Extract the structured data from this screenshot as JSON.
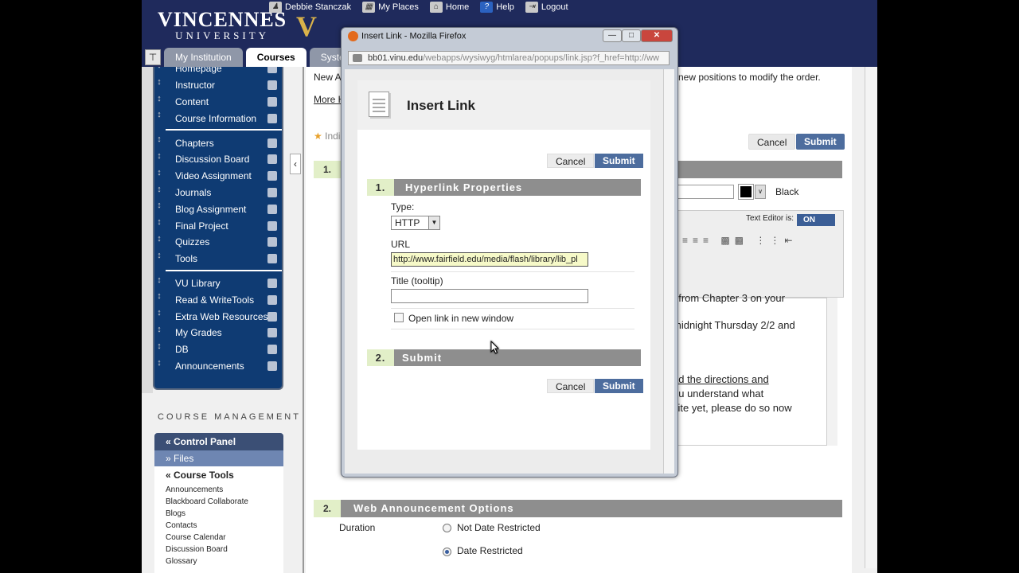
{
  "header": {
    "logo_main": "VINCENNES",
    "logo_sub": "UNIVERSITY",
    "user": "Debbie Stanczak",
    "links": [
      "My Places",
      "Home",
      "Help",
      "Logout"
    ]
  },
  "tabs": [
    "My Institution",
    "Courses",
    "Syste"
  ],
  "left_nav": {
    "group1": [
      "Homepage",
      "Instructor",
      "Content",
      "Course Information"
    ],
    "group2": [
      "Chapters",
      "Discussion Board",
      "Video Assignment",
      "Journals",
      "Blog Assignment",
      "Final Project",
      "Quizzes",
      "Tools"
    ],
    "group3": [
      "VU Library",
      "Read & WriteTools",
      "Extra Web Resources",
      "My Grades",
      "DB",
      "Announcements"
    ]
  },
  "course_management": {
    "title": "COURSE MANAGEMENT",
    "control_panel": "Control Panel",
    "files": "Files",
    "course_tools": "Course Tools",
    "tools": [
      "Announcements",
      "Blackboard Collaborate",
      "Blogs",
      "Contacts",
      "Course Calendar",
      "Discussion Board",
      "Glossary"
    ]
  },
  "main": {
    "intro": "New A",
    "intro_right": "new positions to modify the order.",
    "more_help": "More H",
    "indicates": "Indi",
    "cancel": "Cancel",
    "submit": "Submit",
    "section1_num": "1.",
    "color_label": "Black",
    "text_editor_label": "Text Editor is:",
    "text_editor_state": "ON",
    "body_line1": "t from Chapter 3 on your",
    "body_line2": "midnight Thursday 2/2 and",
    "body_line3": "ad the directions and",
    "body_line4": "ou understand what",
    "body_line5": "site yet, please do so now",
    "section2_num": "2.",
    "section2_title": "Web Announcement Options",
    "duration_label": "Duration",
    "opt_not_restricted": "Not Date Restricted",
    "opt_restricted": "Date Restricted"
  },
  "firefox": {
    "title": "Insert Link - Mozilla Firefox",
    "url_host": "bb01.vinu.edu",
    "url_path": "/webapps/wysiwyg/htmlarea/popups/link.jsp?f_href=http://ww"
  },
  "dialog": {
    "title": "Insert Link",
    "cancel": "Cancel",
    "submit": "Submit",
    "section1_num": "1.",
    "section1_title": "Hyperlink Properties",
    "type_label": "Type:",
    "type_value": "HTTP",
    "url_label": "URL",
    "url_value": "http://www.fairfield.edu/media/flash/library/lib_pl",
    "title_label": "Title (tooltip)",
    "title_value": "",
    "new_window_label": "Open link in new window",
    "section2_num": "2.",
    "section2_title": "Submit"
  }
}
